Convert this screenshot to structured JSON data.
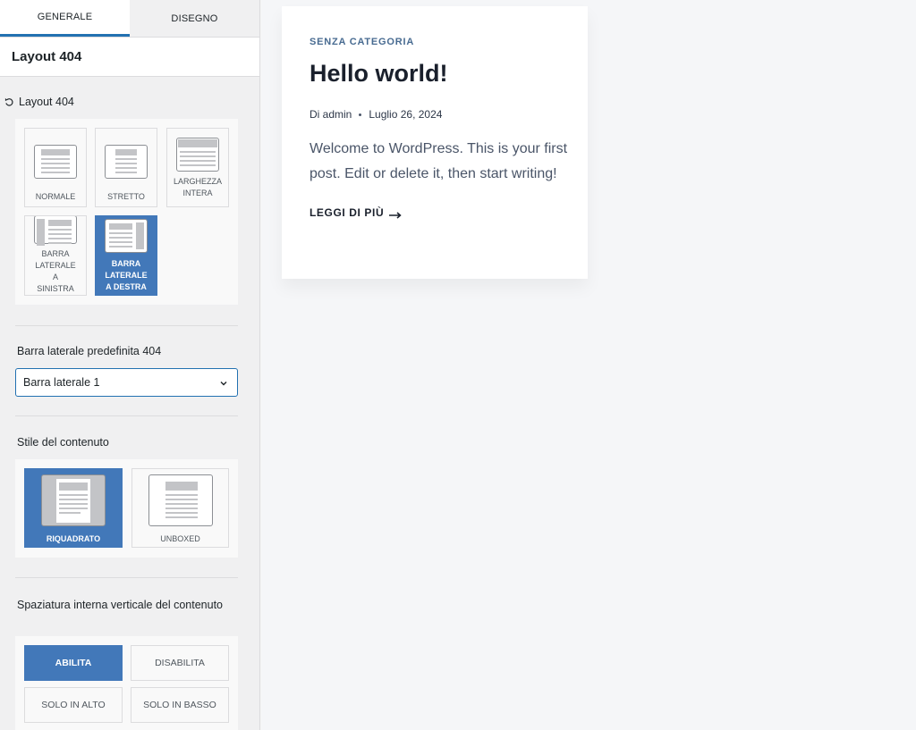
{
  "tabs": [
    {
      "label": "GENERALE",
      "active": true
    },
    {
      "label": "DISEGNO",
      "active": false
    }
  ],
  "section_title": "Layout 404",
  "layout": {
    "heading": "Layout 404",
    "options": [
      {
        "label": "NORMALE",
        "icon": "layout-normal-icon",
        "selected": false
      },
      {
        "label": "STRETTO",
        "icon": "layout-narrow-icon",
        "selected": false
      },
      {
        "label": "LARGHEZZA INTERA",
        "icon": "layout-fullwidth-icon",
        "selected": false
      },
      {
        "label": "BARRA LATERALE A SINISTRA",
        "icon": "layout-left-sidebar-icon",
        "selected": false
      },
      {
        "label": "BARRA LATERALE A DESTRA",
        "icon": "layout-right-sidebar-icon",
        "selected": true
      }
    ]
  },
  "sidebar_select": {
    "label": "Barra laterale predefinita 404",
    "value": "Barra laterale 1"
  },
  "content_style": {
    "label": "Stile del contenuto",
    "options": [
      {
        "label": "RIQUADRATO",
        "icon": "boxed-style-icon",
        "selected": true
      },
      {
        "label": "UNBOXED",
        "icon": "unboxed-style-icon",
        "selected": false
      }
    ]
  },
  "vertical_padding": {
    "label": "Spaziatura interna verticale del contenuto",
    "options": [
      {
        "label": "ABILITA",
        "selected": true
      },
      {
        "label": "DISABILITA",
        "selected": false
      },
      {
        "label": "SOLO IN ALTO",
        "selected": false
      },
      {
        "label": "SOLO IN BASSO",
        "selected": false
      }
    ]
  },
  "post": {
    "category": "SENZA CATEGORIA",
    "title": "Hello world!",
    "author": "Di admin",
    "date": "Luglio 26, 2024",
    "excerpt": "Welcome to WordPress. This is your first post. Edit or delete it, then start writing!",
    "read_more": "LEGGI DI PIÙ"
  },
  "colors": {
    "accent": "#4278b9",
    "tab_indicator": "#2271b1",
    "category_link": "#486b91"
  }
}
